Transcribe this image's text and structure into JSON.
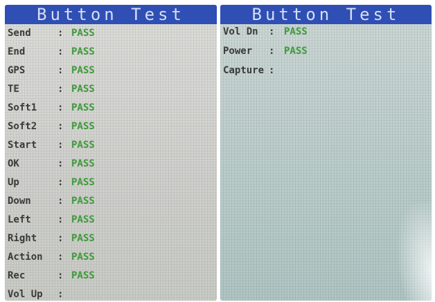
{
  "panels": [
    {
      "title": "Button Test",
      "rows": [
        {
          "label": "Send",
          "separator": ":",
          "status": "PASS"
        },
        {
          "label": "End",
          "separator": ":",
          "status": "PASS"
        },
        {
          "label": "GPS",
          "separator": ":",
          "status": "PASS"
        },
        {
          "label": "TE",
          "separator": ":",
          "status": "PASS"
        },
        {
          "label": "Soft1",
          "separator": ":",
          "status": "PASS"
        },
        {
          "label": "Soft2",
          "separator": ":",
          "status": "PASS"
        },
        {
          "label": "Start",
          "separator": ":",
          "status": "PASS"
        },
        {
          "label": "OK",
          "separator": ":",
          "status": "PASS"
        },
        {
          "label": "Up",
          "separator": ":",
          "status": "PASS"
        },
        {
          "label": "Down",
          "separator": ":",
          "status": "PASS"
        },
        {
          "label": "Left",
          "separator": ":",
          "status": "PASS"
        },
        {
          "label": "Right",
          "separator": ":",
          "status": "PASS"
        },
        {
          "label": "Action",
          "separator": ":",
          "status": "PASS"
        },
        {
          "label": "Rec",
          "separator": ":",
          "status": "PASS"
        },
        {
          "label": "Vol Up",
          "separator": ":",
          "status": ""
        }
      ]
    },
    {
      "title": "Button Test",
      "rows": [
        {
          "label": "Vol Dn",
          "separator": ":",
          "status": "PASS"
        },
        {
          "label": "Power",
          "separator": ":",
          "status": "PASS"
        },
        {
          "label": "Capture",
          "separator": ":",
          "status": ""
        }
      ]
    }
  ],
  "colors": {
    "title_bar": "#2f4fb4",
    "title_text": "#d7dff5",
    "label_text": "#3a3a38",
    "pass_text": "#3f9a3a"
  }
}
